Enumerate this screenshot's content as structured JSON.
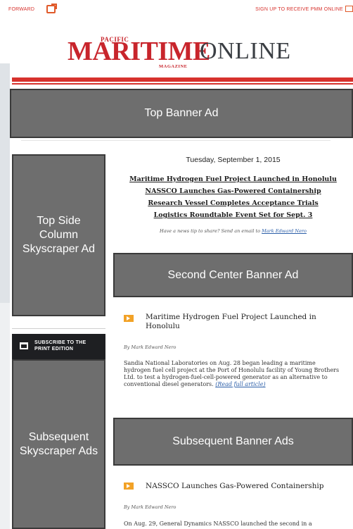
{
  "utility_bar": {
    "forward_label": "FORWARD",
    "signup_label": "SIGN UP TO RECEIVE PMM ONLINE"
  },
  "masthead": {
    "pacific": "PACIFIC",
    "maritime": "MARITIME",
    "online": "ONLINE",
    "magazine": "MAGAZINE"
  },
  "ads": {
    "top_banner": "Top Banner Ad",
    "top_side": "Top Side Column Skyscraper Ad",
    "second_center": "Second Center Banner Ad",
    "subsequent_side": "Subsequent Skyscraper Ads",
    "subsequent_banner": "Subsequent Banner Ads"
  },
  "subscribe": {
    "line1": "SUBSCRIBE TO THE",
    "line2": "PRINT EDITION"
  },
  "newsletter": {
    "date": "Tuesday, September 1, 2015",
    "toc": [
      "Maritime Hydrogen Fuel Project Launched in Honolulu",
      "NASSCO Launches Gas-Powered Containership",
      "Research Vessel Completes Acceptance Trials",
      "Logistics Roundtable Event Set for Sept. 3"
    ],
    "share_text": "Have a news tip to share? Send an email to",
    "share_author": "Mark Edward Nero"
  },
  "articles": [
    {
      "title": "Maritime Hydrogen Fuel Project Launched in Honolulu",
      "byline": "By Mark Edward Nero",
      "body": "Sandia National Laboratories on Aug. 28 began leading a maritime hydrogen fuel cell project at the Port of Honolulu facility of Young Brothers Ltd. to test a hydrogen-fuel-cell-powered generator as an alternative to conventional diesel generators.",
      "readmore": "(Read full article)"
    },
    {
      "title": "NASSCO Launches Gas-Powered Containership",
      "byline": "By Mark Edward Nero",
      "body": "On Aug. 29, General Dynamics NASSCO launched the second in a"
    }
  ]
}
